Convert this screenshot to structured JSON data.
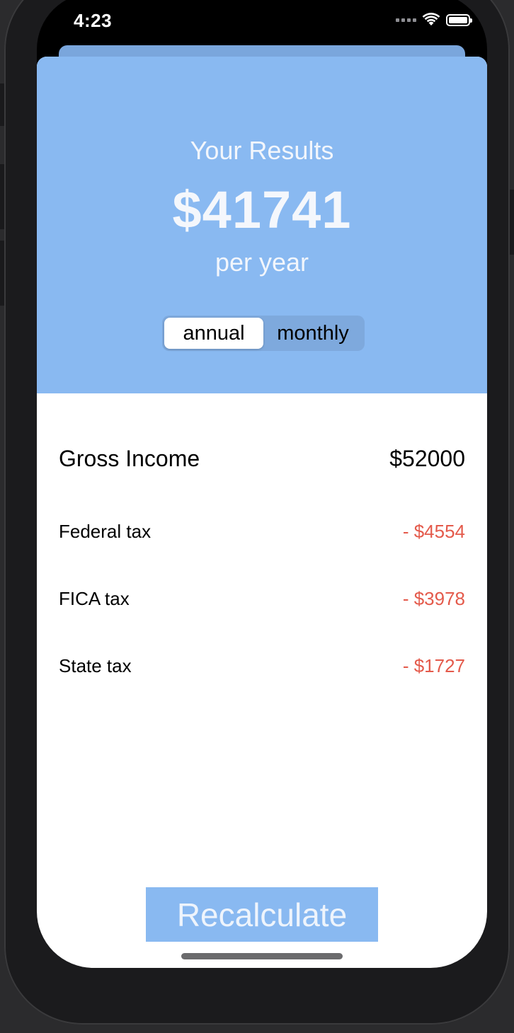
{
  "status_bar": {
    "time": "4:23",
    "wifi_icon": "wifi-icon",
    "battery_icon": "battery-icon"
  },
  "header": {
    "title": "Your Results",
    "amount": "$41741",
    "period_label": "per year"
  },
  "period_toggle": {
    "options": [
      "annual",
      "monthly"
    ],
    "selected": "annual"
  },
  "breakdown": {
    "gross": {
      "label": "Gross Income",
      "value": "$52000"
    },
    "taxes": [
      {
        "label": "Federal tax",
        "value": "- $4554"
      },
      {
        "label": "FICA tax",
        "value": "- $3978"
      },
      {
        "label": "State tax",
        "value": "- $1727"
      }
    ]
  },
  "actions": {
    "recalculate_label": "Recalculate"
  },
  "colors": {
    "accent": "#89b9f1",
    "deduction": "#e45a4b"
  }
}
